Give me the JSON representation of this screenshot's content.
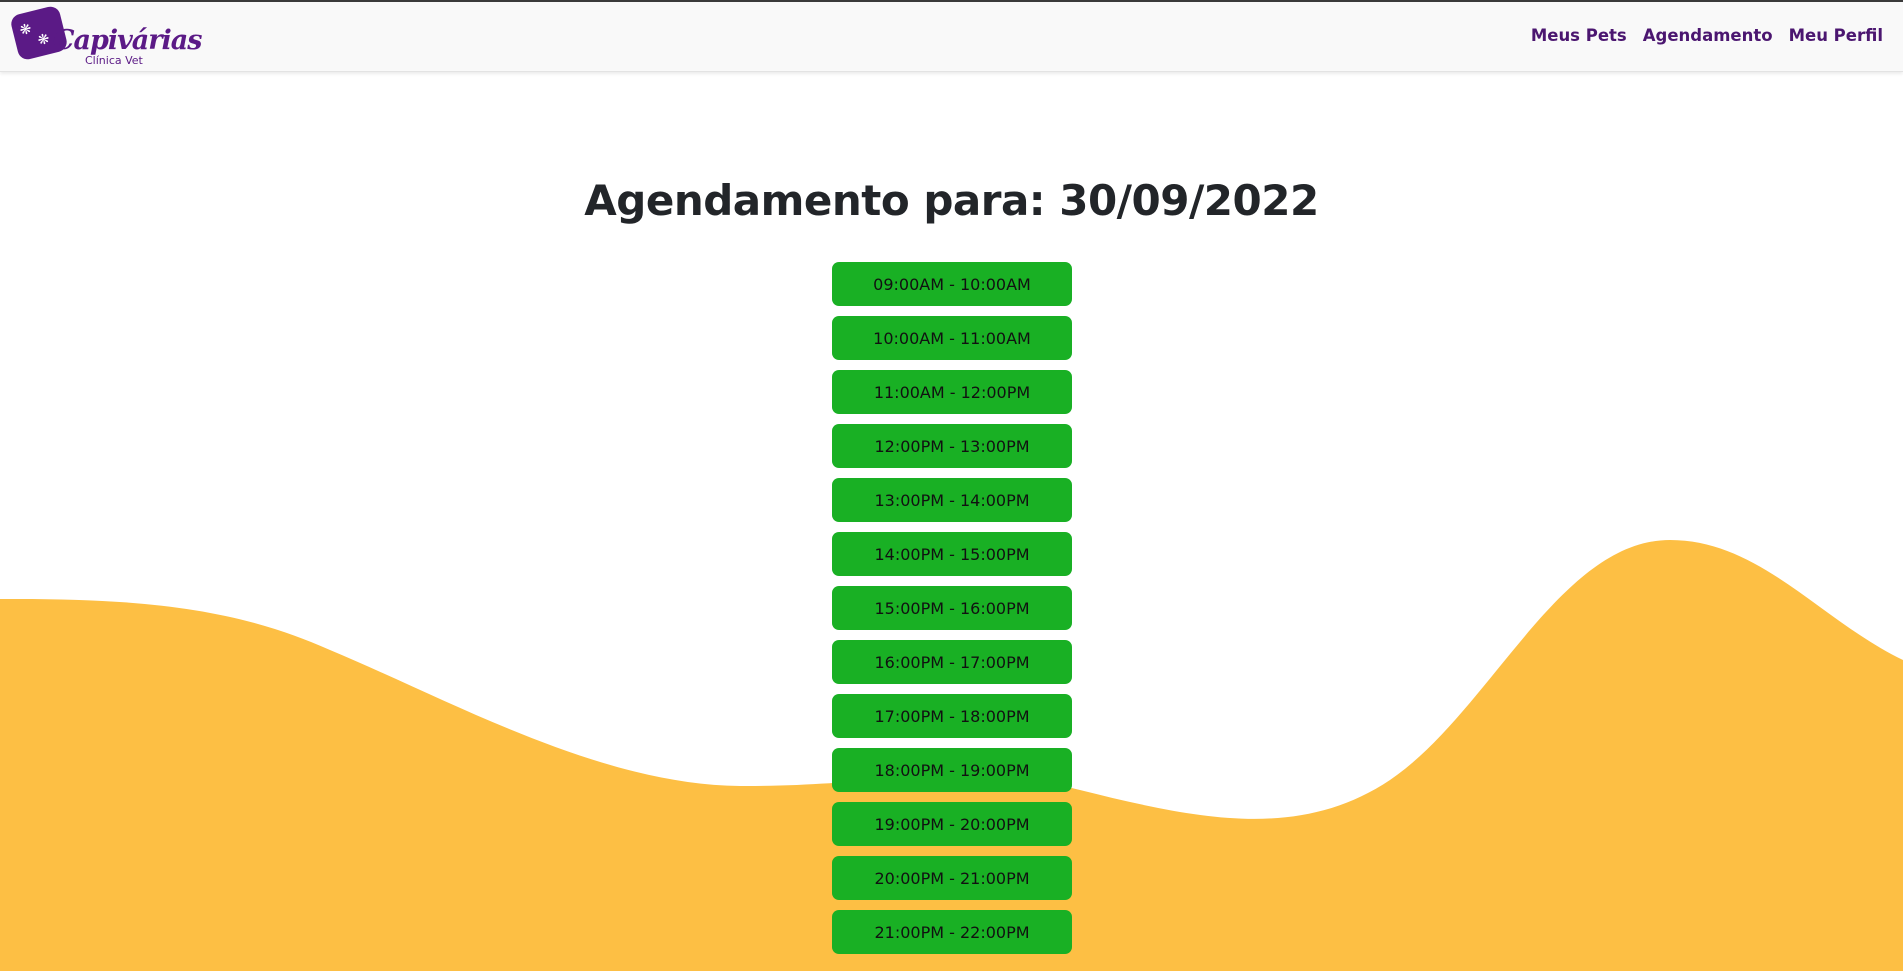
{
  "brand": {
    "name": "Capivárias",
    "subtitle": "Clínica Vet",
    "logo_icon": "paw-icon",
    "color": "#5b1a86"
  },
  "nav": {
    "items": [
      {
        "label": "Meus Pets"
      },
      {
        "label": "Agendamento"
      },
      {
        "label": "Meu Perfil"
      }
    ]
  },
  "page": {
    "title": "Agendamento para: 30/09/2022"
  },
  "slots": [
    "09:00AM - 10:00AM",
    "10:00AM - 11:00AM",
    "11:00AM - 12:00PM",
    "12:00PM - 13:00PM",
    "13:00PM - 14:00PM",
    "14:00PM - 15:00PM",
    "15:00PM - 16:00PM",
    "16:00PM - 17:00PM",
    "17:00PM - 18:00PM",
    "18:00PM - 19:00PM",
    "19:00PM - 20:00PM",
    "20:00PM - 21:00PM",
    "21:00PM - 22:00PM"
  ],
  "colors": {
    "slot_background": "#19b024",
    "wave": "#fdbf44",
    "nav_text": "#4b1670"
  }
}
